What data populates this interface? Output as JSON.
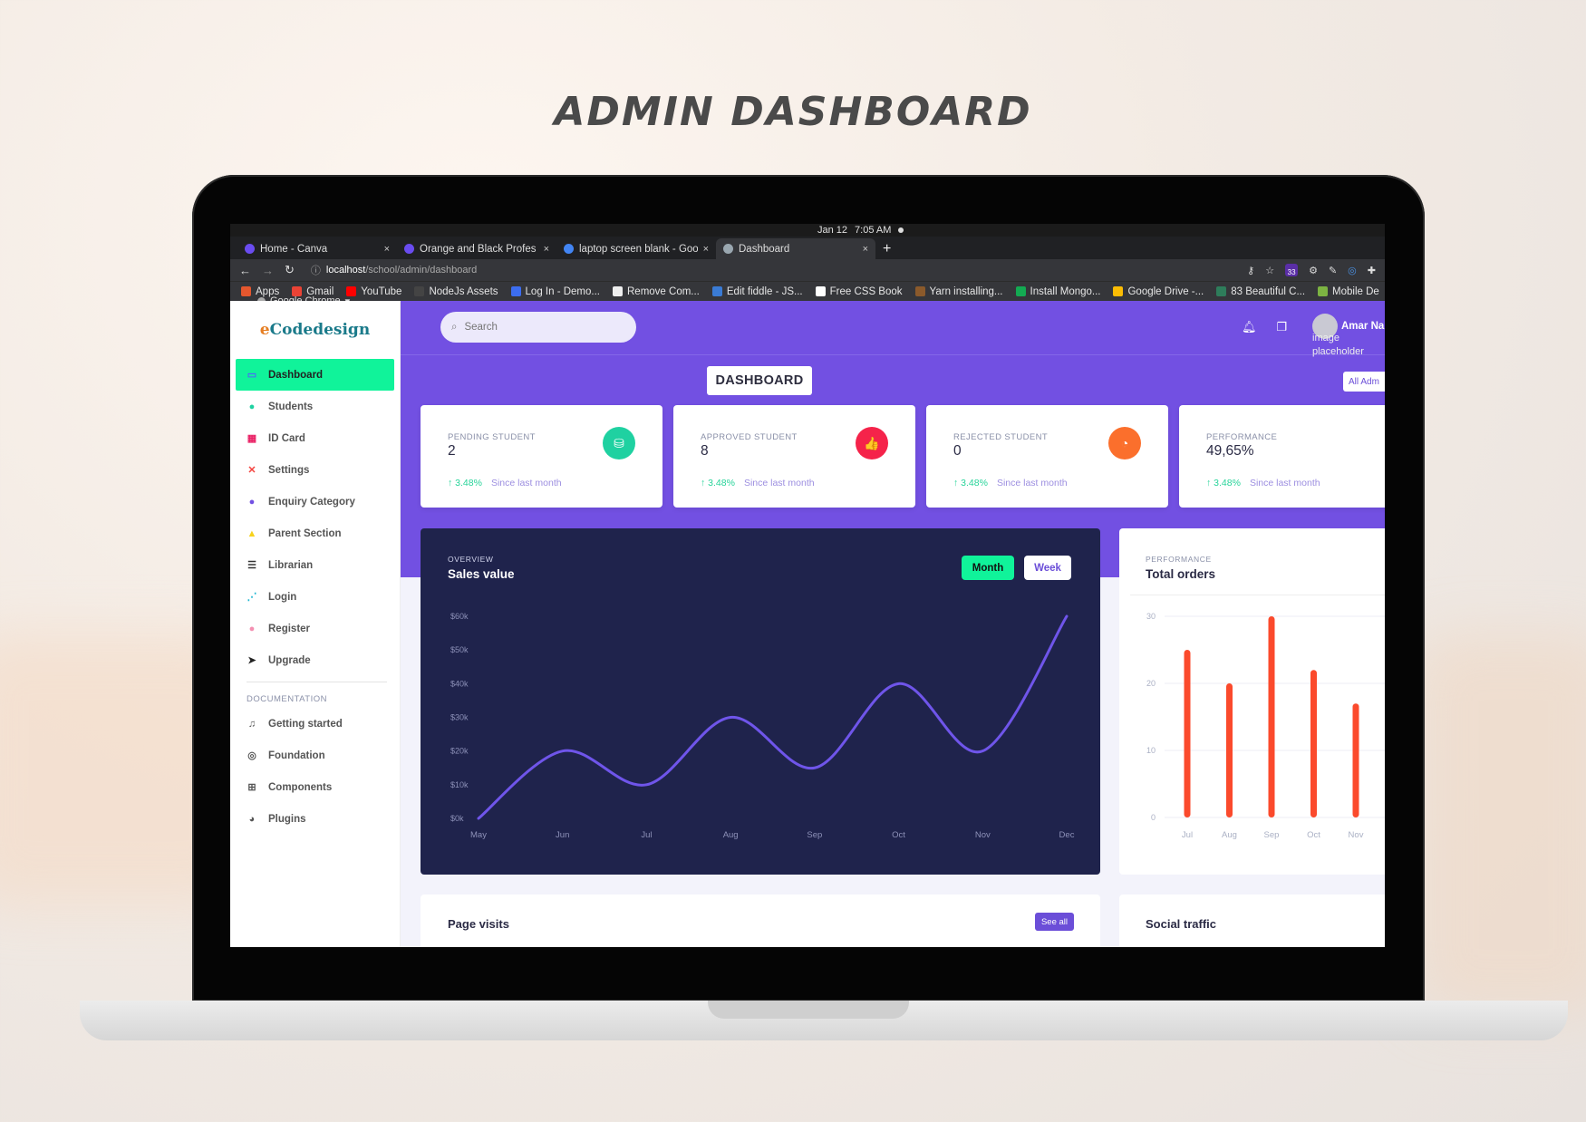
{
  "promo": {
    "title": "ADMIN DASHBOARD"
  },
  "os": {
    "app_name": "Google Chrome",
    "date": "Jan 12",
    "time": "7:05 AM"
  },
  "browser": {
    "tabs": [
      {
        "label": "Home - Canva",
        "color": "#6a4cf0"
      },
      {
        "label": "Orange and Black Profes",
        "color": "#6a4cf0"
      },
      {
        "label": "laptop screen blank - Goo",
        "color": "#4285f4"
      },
      {
        "label": "Dashboard",
        "color": "#9aa7b0",
        "active": true
      }
    ],
    "new_tab": "+",
    "close": "×",
    "url_host": "localhost",
    "url_path": "/school/admin/dashboard",
    "extension_badge": "33",
    "bookmarks": [
      {
        "label": "Apps",
        "color": "#e4572e"
      },
      {
        "label": "Gmail",
        "color": "#ea4335"
      },
      {
        "label": "YouTube",
        "color": "#ff0000"
      },
      {
        "label": "NodeJs Assets",
        "color": "#444"
      },
      {
        "label": "Log In - Demo...",
        "color": "#3c6df0"
      },
      {
        "label": "Remove Com...",
        "color": "#eee"
      },
      {
        "label": "Edit fiddle - JS...",
        "color": "#3a7bd5"
      },
      {
        "label": "Free CSS Book",
        "color": "#fff"
      },
      {
        "label": "Yarn installing...",
        "color": "#8b5a2b"
      },
      {
        "label": "Install Mongo...",
        "color": "#13aa52"
      },
      {
        "label": "Google Drive -...",
        "color": "#fbbc04"
      },
      {
        "label": "83 Beautiful C...",
        "color": "#2e7d5b"
      },
      {
        "label": "Mobile De",
        "color": "#7cb342"
      }
    ]
  },
  "brand": {
    "prefix": "e",
    "name": "Codedesign"
  },
  "sidebar": {
    "items": [
      {
        "label": "Dashboard",
        "icon": "monitor-icon",
        "glyph": "▭",
        "color": "#4a6cf7",
        "active": true
      },
      {
        "label": "Students",
        "icon": "user-circle-icon",
        "glyph": "●",
        "color": "#1fd1a1"
      },
      {
        "label": "ID Card",
        "icon": "id-card-icon",
        "glyph": "▦",
        "color": "#e91e63"
      },
      {
        "label": "Settings",
        "icon": "tools-icon",
        "glyph": "✕",
        "color": "#f4433f"
      },
      {
        "label": "Enquiry Category",
        "icon": "map-pin-icon",
        "glyph": "●",
        "color": "#7250e2"
      },
      {
        "label": "Parent Section",
        "icon": "person-icon",
        "glyph": "▲",
        "color": "#f7d21c"
      },
      {
        "label": "Librarian",
        "icon": "list-icon",
        "glyph": "☰",
        "color": "#333"
      },
      {
        "label": "Login",
        "icon": "share-icon",
        "glyph": "⋰",
        "color": "#1fb6d1"
      },
      {
        "label": "Register",
        "icon": "user-add-icon",
        "glyph": "●",
        "color": "#f48fb1"
      },
      {
        "label": "Upgrade",
        "icon": "paper-plane-icon",
        "glyph": "➤",
        "color": "#222"
      }
    ],
    "section_label": "DOCUMENTATION",
    "docs": [
      {
        "label": "Getting started",
        "icon": "rocket-icon",
        "glyph": "♫"
      },
      {
        "label": "Foundation",
        "icon": "palette-icon",
        "glyph": "◎"
      },
      {
        "label": "Components",
        "icon": "components-icon",
        "glyph": "⊞"
      },
      {
        "label": "Plugins",
        "icon": "pie-icon",
        "glyph": "◕"
      }
    ]
  },
  "header": {
    "search_placeholder": "Search",
    "user_name": "Amar Na",
    "avatar_alt": "image placeholder",
    "page_title": "DASHBOARD",
    "all_admin_label": "All Adm"
  },
  "stats": [
    {
      "label": "PENDING STUDENT",
      "value": "2",
      "delta": "3.48%",
      "since": "Since last month",
      "icon": "database-icon",
      "glyph": "⛁",
      "color": "#1fd1a1"
    },
    {
      "label": "APPROVED STUDENT",
      "value": "8",
      "delta": "3.48%",
      "since": "Since last month",
      "icon": "thumbs-up-icon",
      "glyph": "👍",
      "color": "#f5234a"
    },
    {
      "label": "REJECTED STUDENT",
      "value": "0",
      "delta": "3.48%",
      "since": "Since last month",
      "icon": "pie-chart-icon",
      "glyph": "◔",
      "color": "#fb6f2c"
    },
    {
      "label": "PERFORMANCE",
      "value": "49,65%",
      "delta": "3.48%",
      "since": "Since last month",
      "icon": "",
      "glyph": "",
      "color": "#fff"
    }
  ],
  "overview": {
    "kicker": "OVERVIEW",
    "title": "Sales value",
    "btn_month": "Month",
    "btn_week": "Week"
  },
  "orders_card": {
    "kicker": "PERFORMANCE",
    "title": "Total orders"
  },
  "page_visits": {
    "title": "Page visits",
    "see_all": "See all"
  },
  "social": {
    "title": "Social traffic"
  },
  "chart_data": [
    {
      "type": "line",
      "title": "Sales value",
      "x": [
        "May",
        "Jun",
        "Jul",
        "Aug",
        "Sep",
        "Oct",
        "Nov",
        "Dec"
      ],
      "values": [
        0,
        20,
        10,
        30,
        15,
        40,
        20,
        60
      ],
      "yticks": [
        "$0k",
        "$10k",
        "$20k",
        "$30k",
        "$40k",
        "$50k",
        "$60k"
      ],
      "ylim": [
        0,
        60
      ],
      "ylabel": "",
      "xlabel": "",
      "grid": false,
      "line_color": "#6f55ea"
    },
    {
      "type": "bar",
      "title": "Total orders",
      "categories": [
        "Jul",
        "Aug",
        "Sep",
        "Oct",
        "Nov"
      ],
      "values": [
        25,
        20,
        30,
        22,
        17
      ],
      "yticks": [
        "0",
        "10",
        "20",
        "30"
      ],
      "ylim": [
        0,
        30
      ],
      "grid": true,
      "bar_color": "#fb4a2c"
    }
  ]
}
